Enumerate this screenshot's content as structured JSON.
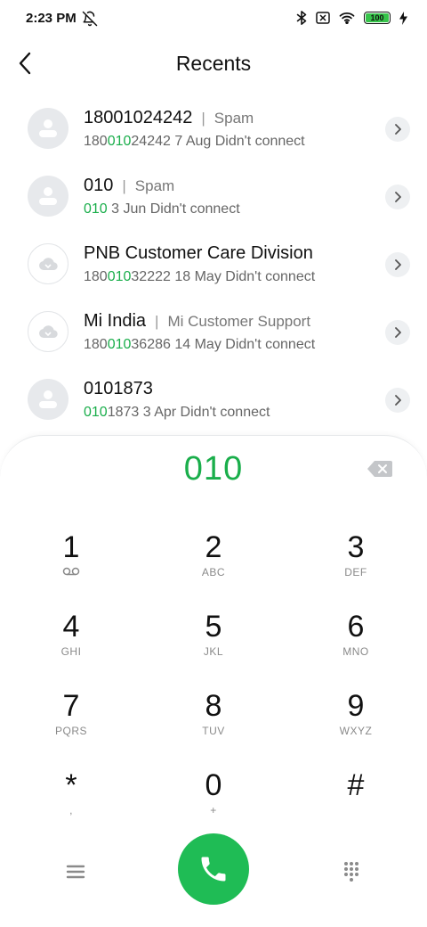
{
  "status_bar": {
    "time": "2:23 PM",
    "battery_level": "100",
    "icons": [
      "bell-off-icon",
      "bluetooth-icon",
      "no-sim-icon",
      "wifi-icon",
      "battery-icon",
      "charging-icon"
    ]
  },
  "header": {
    "title": "Recents"
  },
  "recents": [
    {
      "name": "18001024242",
      "tag": "Spam",
      "num_pre": "180",
      "num_hl": "010",
      "num_post": "24242",
      "detail": "7 Aug Didn't connect",
      "avatar": "person-icon"
    },
    {
      "name": "010",
      "tag": "Spam",
      "num_pre": "",
      "num_hl": "010",
      "num_post": "",
      "detail": "3 Jun Didn't connect",
      "avatar": "person-icon"
    },
    {
      "name": "PNB Customer Care Division",
      "tag": "",
      "num_pre": "180",
      "num_hl": "010",
      "num_post": "32222",
      "detail": "18 May Didn't connect",
      "avatar": "cloud-icon"
    },
    {
      "name": "Mi India",
      "tag": "Mi Customer Support",
      "num_pre": "180",
      "num_hl": "010",
      "num_post": "36286",
      "detail": "14 May Didn't connect",
      "avatar": "cloud-icon"
    },
    {
      "name": "0101873",
      "tag": "",
      "num_pre": "",
      "num_hl": "010",
      "num_post": "1873",
      "detail": "3 Apr Didn't connect",
      "avatar": "person-icon"
    }
  ],
  "dialer": {
    "input_value": "010",
    "keys": [
      {
        "digit": "1",
        "letters": ""
      },
      {
        "digit": "2",
        "letters": "ABC"
      },
      {
        "digit": "3",
        "letters": "DEF"
      },
      {
        "digit": "4",
        "letters": "GHI"
      },
      {
        "digit": "5",
        "letters": "JKL"
      },
      {
        "digit": "6",
        "letters": "MNO"
      },
      {
        "digit": "7",
        "letters": "PQRS"
      },
      {
        "digit": "8",
        "letters": "TUV"
      },
      {
        "digit": "9",
        "letters": "WXYZ"
      },
      {
        "digit": "*",
        "letters": ","
      },
      {
        "digit": "0",
        "letters": "+"
      },
      {
        "digit": "#",
        "letters": ""
      }
    ]
  },
  "colors": {
    "accent_green": "#1aae4b",
    "call_button": "#1fbc55"
  }
}
